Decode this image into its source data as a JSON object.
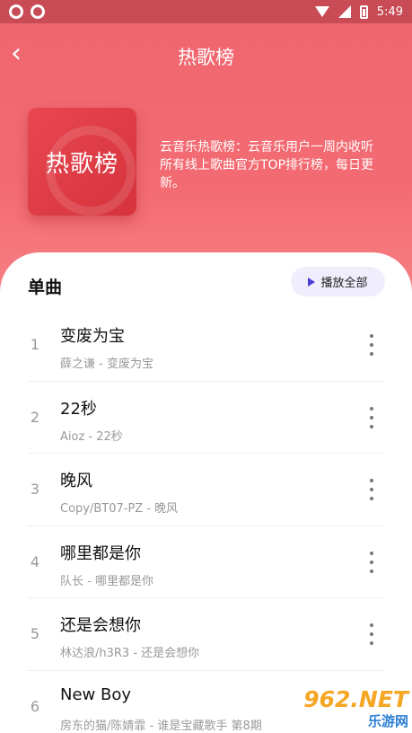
{
  "status_bar": {
    "time": "5:49"
  },
  "header": {
    "title": "热歌榜",
    "back_icon": "back-arrow-icon"
  },
  "cover": {
    "text": "热歌榜"
  },
  "description": "云音乐热歌榜：云音乐用户一周内收听所有线上歌曲官方TOP排行榜，每日更新。",
  "section": {
    "title": "单曲",
    "play_all_label": "播放全部"
  },
  "songs": [
    {
      "num": "1",
      "title": "变废为宝",
      "sub": "薛之谦 - 变废为宝"
    },
    {
      "num": "2",
      "title": "22秒",
      "sub": "Aioz - 22秒"
    },
    {
      "num": "3",
      "title": "晚风",
      "sub": "Copy/BT07-PZ - 晚风"
    },
    {
      "num": "4",
      "title": "哪里都是你",
      "sub": "队长 - 哪里都是你"
    },
    {
      "num": "5",
      "title": "还是会想你",
      "sub": "林达浪/h3R3 - 还是会想你"
    },
    {
      "num": "6",
      "title": "New Boy",
      "sub": "房东的猫/陈婧霏 - 谁是宝藏歌手 第8期"
    }
  ],
  "watermark": {
    "top": "962.NET",
    "bottom": "乐游网"
  }
}
